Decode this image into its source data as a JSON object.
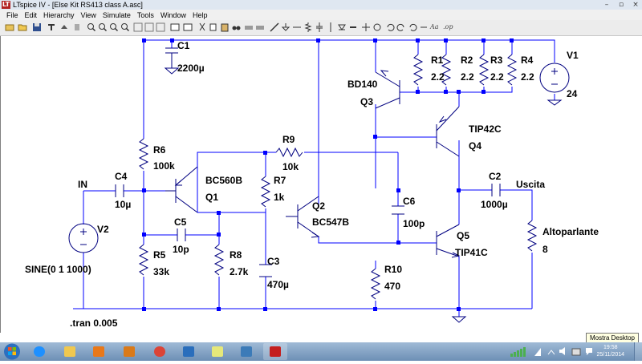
{
  "window": {
    "app_icon": "lt-logo-icon",
    "title": "LTspice IV - [Else Kit RS413 class A.asc]",
    "minimize": "–",
    "restore": "▫",
    "close": "×"
  },
  "menu": [
    "File",
    "Edit",
    "Hierarchy",
    "View",
    "Simulate",
    "Tools",
    "Window",
    "Help"
  ],
  "toolbar": {
    "text_tool": "Aa",
    "op_tool": ".op"
  },
  "schematic": {
    "C1": {
      "name": "C1",
      "value": "2200µ"
    },
    "R1": {
      "name": "R1",
      "value": "2.2"
    },
    "R2": {
      "name": "R2",
      "value": "2.2"
    },
    "R3": {
      "name": "R3",
      "value": "2.2"
    },
    "R4": {
      "name": "R4",
      "value": "2.2"
    },
    "V1": {
      "name": "V1",
      "value": "24"
    },
    "Q3": {
      "name": "Q3",
      "value": "BD140"
    },
    "Q4": {
      "name": "Q4",
      "value": "TIP42C"
    },
    "R9": {
      "name": "R9",
      "value": "10k"
    },
    "R6": {
      "name": "R6",
      "value": "100k"
    },
    "R7": {
      "name": "R7",
      "value": "1k"
    },
    "Q1": {
      "name": "Q1",
      "value": "BC560B"
    },
    "Q2": {
      "name": "Q2",
      "value": "BC547B"
    },
    "C4": {
      "name": "C4",
      "value": "10µ"
    },
    "C5": {
      "name": "C5",
      "value": "10p"
    },
    "C6": {
      "name": "C6",
      "value": "100p"
    },
    "C2": {
      "name": "C2",
      "value": "1000µ"
    },
    "C3": {
      "name": "C3",
      "value": "470µ"
    },
    "V2": {
      "name": "V2",
      "value": "SINE(0 1 1000)"
    },
    "R5": {
      "name": "R5",
      "value": "33k"
    },
    "R8": {
      "name": "R8",
      "value": "2.7k"
    },
    "R10": {
      "name": "R10",
      "value": "470"
    },
    "Q5": {
      "name": "Q5",
      "value": "TIP41C"
    },
    "speaker": {
      "name": "Altoparlante",
      "value": "8"
    },
    "in_label": "IN",
    "out_label": "Uscita",
    "directive": ".tran 0.005"
  },
  "tooltip": "Mostra Desktop",
  "taskbar": {
    "apps": [
      "windows-start-icon",
      "internet-explorer-icon",
      "file-explorer-icon",
      "media-player-icon",
      "outlook-icon",
      "chrome-icon",
      "maxthon-icon",
      "notes-icon",
      "remote-desktop-icon",
      "ltspice-icon"
    ],
    "time": "19:58",
    "date": "25/11/2014"
  },
  "colors": {
    "wire": "#0000ff",
    "symbol": "#000080",
    "canvas": "#ffffff"
  }
}
